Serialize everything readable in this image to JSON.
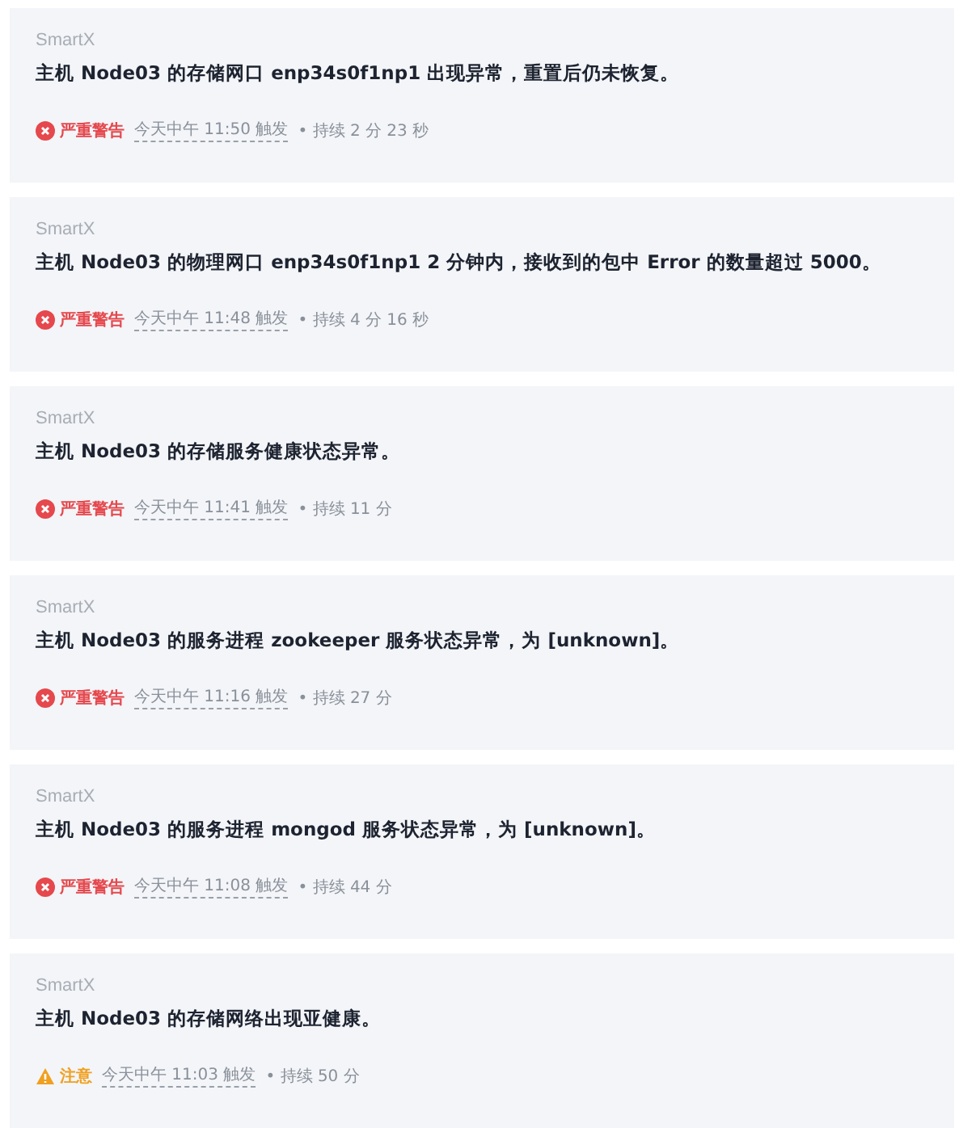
{
  "alerts": [
    {
      "source": "SmartX",
      "message": "主机 Node03 的存储网口 enp34s0f1np1 出现异常，重置后仍未恢复。",
      "kind": "critical",
      "level_label": "严重警告",
      "triggered": "今天中午 11:50 触发",
      "duration": "• 持续 2 分 23 秒"
    },
    {
      "source": "SmartX",
      "message": "主机 Node03 的物理网口 enp34s0f1np1 2 分钟内，接收到的包中 Error 的数量超过 5000。",
      "kind": "critical",
      "level_label": "严重警告",
      "triggered": "今天中午 11:48 触发",
      "duration": "• 持续 4 分 16 秒"
    },
    {
      "source": "SmartX",
      "message": "主机 Node03 的存储服务健康状态异常。",
      "kind": "critical",
      "level_label": "严重警告",
      "triggered": "今天中午 11:41 触发",
      "duration": "• 持续 11 分"
    },
    {
      "source": "SmartX",
      "message": "主机 Node03 的服务进程 zookeeper 服务状态异常，为 [unknown]。",
      "kind": "critical",
      "level_label": "严重警告",
      "triggered": "今天中午 11:16 触发",
      "duration": "• 持续 27 分"
    },
    {
      "source": "SmartX",
      "message": "主机 Node03 的服务进程 mongod 服务状态异常，为 [unknown]。",
      "kind": "critical",
      "level_label": "严重警告",
      "triggered": "今天中午 11:08 触发",
      "duration": "• 持续 44 分"
    },
    {
      "source": "SmartX",
      "message": "主机 Node03 的存储网络出现亚健康。",
      "kind": "notice",
      "level_label": "注意",
      "triggered": "今天中午 11:03 触发",
      "duration": "• 持续 50 分"
    }
  ]
}
